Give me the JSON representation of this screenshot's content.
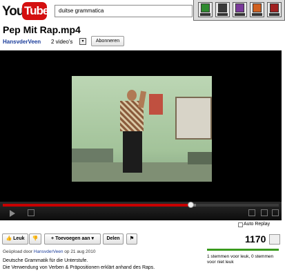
{
  "logo": {
    "you": "You",
    "tube": "Tube"
  },
  "search": {
    "value": "duitse grammatica"
  },
  "toolbar": {
    "buttons": [
      "tool-1",
      "tool-2",
      "tool-3",
      "tool-4",
      "tool-5"
    ]
  },
  "video": {
    "title": "Pep Mit Rap.mp4",
    "channel": "HansvderVeen",
    "videos_count": "2 video's",
    "subscribe_label": "Abonneren",
    "progress": 0.68,
    "loaded": 0.7
  },
  "auto_replay": "Auto Replay",
  "actions": {
    "like_label": "Leuk",
    "add_label": "Toevoegen aan",
    "share_label": "Delen"
  },
  "views": "1170",
  "votes_text": "1 stemmen voor leuk, 0 stemmen voor niet leuk",
  "uploaded": {
    "prefix": "Geüpload door",
    "channel": "HansvderVeen",
    "date": "op 21 aug 2010"
  },
  "description": [
    "Deutsche Grammatik für die Unterstufe.",
    "Die Verwendung von Verben & Präpositionen erklärt anhand des Raps."
  ],
  "colors": {
    "accent": "#d40f0f",
    "link": "#1a3c9a",
    "like_bar": "#3a9a1e"
  }
}
